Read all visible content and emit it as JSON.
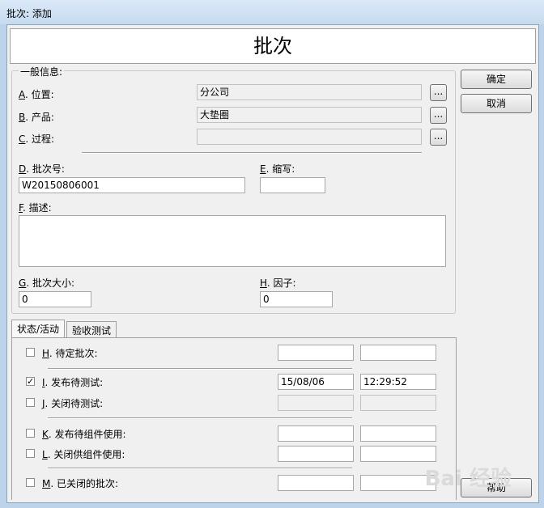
{
  "window": {
    "title": "批次: 添加"
  },
  "header": {
    "title": "批次"
  },
  "general": {
    "legend": "一般信息:",
    "location": {
      "key": "A",
      "label": ". 位置:",
      "value": "分公司"
    },
    "product": {
      "key": "B",
      "label": ". 产品:",
      "value": "大垫圈"
    },
    "process": {
      "key": "C",
      "label": ". 过程:",
      "value": ""
    },
    "lot_number": {
      "key": "D",
      "label": ". 批次号:",
      "value": "W20150806001"
    },
    "abbreviation": {
      "key": "E",
      "label": ". 缩写:",
      "value": ""
    },
    "description": {
      "key": "F",
      "label": ". 描述:",
      "value": ""
    },
    "lot_size": {
      "key": "G",
      "label": ". 批次大小:",
      "value": "0"
    },
    "factor": {
      "key": "H",
      "label": ". 因子:",
      "value": "0"
    },
    "browse_label": "..."
  },
  "buttons": {
    "ok": "确定",
    "cancel": "取消",
    "help": "帮助"
  },
  "tabs": [
    "状态/活动",
    "验收测试"
  ],
  "status": {
    "pending": {
      "key": "H",
      "label": ". 待定批次:",
      "checked": false,
      "date": "",
      "time": ""
    },
    "release_test": {
      "key": "I",
      "label": ". 发布待测试:",
      "checked": true,
      "date": "15/08/06",
      "time": "12:29:52"
    },
    "close_test": {
      "key": "J",
      "label": ". 关闭待测试:",
      "checked": false,
      "date": "",
      "time": ""
    },
    "release_comp": {
      "key": "K",
      "label": ". 发布待组件使用:",
      "checked": false,
      "date": "",
      "time": ""
    },
    "close_comp": {
      "key": "L",
      "label": ". 关闭供组件使用:",
      "checked": false,
      "date": "",
      "time": ""
    },
    "closed": {
      "key": "M",
      "label": ". 已关闭的批次:",
      "checked": false,
      "date": "",
      "time": ""
    }
  },
  "checkmark": "✓",
  "watermark": "Bai 经验"
}
